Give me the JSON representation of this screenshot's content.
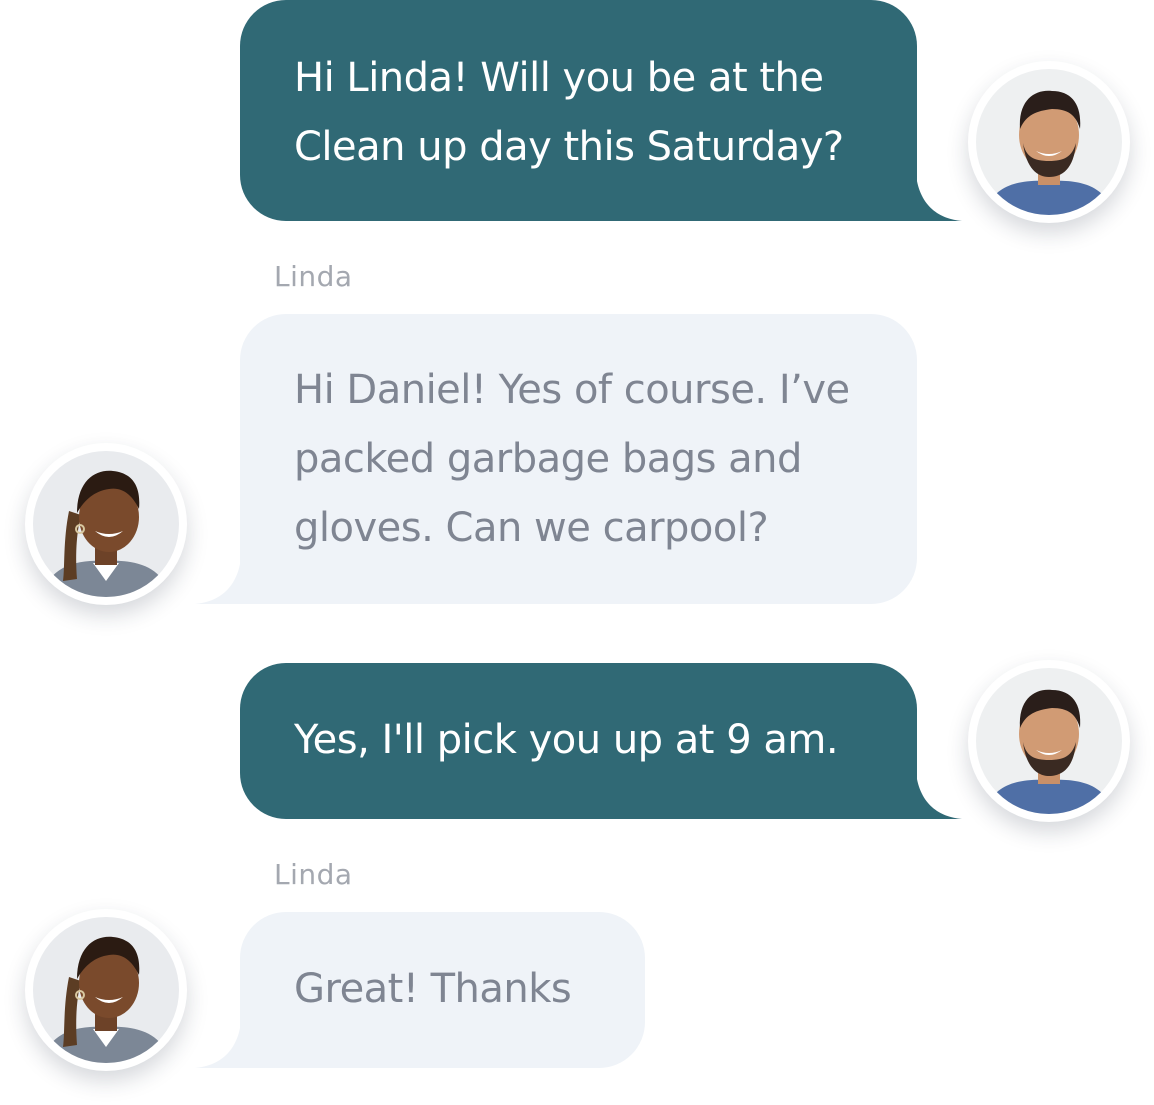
{
  "conversation": {
    "messages": [
      {
        "from": "Daniel",
        "text_line1": "Hi Linda! Will you be at the",
        "text_line2": "Clean up day this Saturday?"
      },
      {
        "from": "Linda",
        "sender_label": "Linda",
        "text_line1": "Hi Daniel! Yes of course. I’ve",
        "text_line2": "packed garbage bags and",
        "text_line3": "gloves. Can we carpool?"
      },
      {
        "from": "Daniel",
        "text": "Yes, I'll pick you up at 9 am."
      },
      {
        "from": "Linda",
        "sender_label": "Linda",
        "text": "Great! Thanks"
      }
    ]
  },
  "colors": {
    "outgoing_bubble": "#306975",
    "incoming_bubble": "#eff3f8",
    "incoming_text": "#7f8592",
    "sender_label": "#a4a8b0"
  },
  "avatars": {
    "daniel": "daniel-avatar",
    "linda": "linda-avatar"
  }
}
